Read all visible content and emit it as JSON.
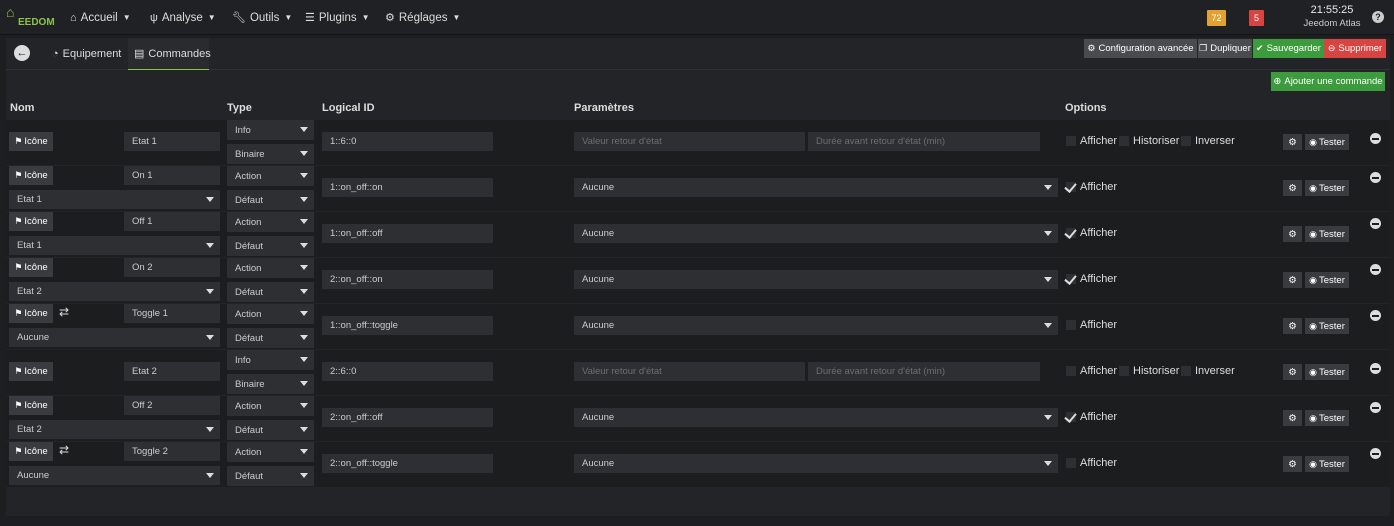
{
  "app": {
    "logo_text": "EEDOM"
  },
  "nav": [
    {
      "label": "Accueil",
      "icon": "home-icon"
    },
    {
      "label": "Analyse",
      "icon": "analysis-icon"
    },
    {
      "label": "Outils",
      "icon": "wrench-icon"
    },
    {
      "label": "Plugins",
      "icon": "list-icon"
    },
    {
      "label": "Réglages",
      "icon": "cog-icon"
    }
  ],
  "badges": [
    {
      "value": "72",
      "color": "#e2a232"
    },
    {
      "value": "5",
      "color": "#d64541"
    }
  ],
  "clock": {
    "time": "21:55:25",
    "name": "Jeedom Atlas"
  },
  "tabs": {
    "equipement": "Equipement",
    "commandes": "Commandes"
  },
  "actions": {
    "config": "Configuration avancée",
    "dupliquer": "Dupliquer",
    "sauvegarder": "Sauvegarder",
    "supprimer": "Supprimer"
  },
  "colors": {
    "green": "#3c9b3c",
    "red": "#d64541",
    "grey_btn": "#4a4b4e"
  },
  "add_command": "Ajouter une commande",
  "headers": {
    "nom": "Nom",
    "type": "Type",
    "logical_id": "Logical ID",
    "parametres": "Paramètres",
    "options": "Options"
  },
  "labels": {
    "icone": "Icône",
    "tester": "Tester",
    "afficher": "Afficher",
    "historiser": "Historiser",
    "inverser": "Inverser",
    "ph_valeur": "Valeur retour d'état",
    "ph_duree": "Durée avant retour d'état (min)"
  },
  "commands": [
    {
      "name": "Etat 1",
      "type": "Info",
      "subtype": "Binaire",
      "logical_id": "1::6::0",
      "kind": "info"
    },
    {
      "name": "On 1",
      "linked": "Etat 1",
      "type": "Action",
      "subtype": "Défaut",
      "logical_id": "1::on_off::on",
      "param": "Aucune",
      "afficher": true,
      "kind": "action"
    },
    {
      "name": "Off 1",
      "linked": "Etat 1",
      "type": "Action",
      "subtype": "Défaut",
      "logical_id": "1::on_off::off",
      "param": "Aucune",
      "afficher": true,
      "kind": "action"
    },
    {
      "name": "On 2",
      "linked": "Etat 2",
      "type": "Action",
      "subtype": "Défaut",
      "logical_id": "2::on_off::on",
      "param": "Aucune",
      "afficher": true,
      "kind": "action"
    },
    {
      "name": "Toggle 1",
      "linked": "Aucune",
      "type": "Action",
      "subtype": "Défaut",
      "logical_id": "1::on_off::toggle",
      "param": "Aucune",
      "afficher": false,
      "kind": "action"
    },
    {
      "name": "Etat 2",
      "type": "Info",
      "subtype": "Binaire",
      "logical_id": "2::6::0",
      "kind": "info"
    },
    {
      "name": "Off 2",
      "linked": "Etat 2",
      "type": "Action",
      "subtype": "Défaut",
      "logical_id": "2::on_off::off",
      "param": "Aucune",
      "afficher": true,
      "kind": "action"
    },
    {
      "name": "Toggle 2",
      "linked": "Aucune",
      "type": "Action",
      "subtype": "Défaut",
      "logical_id": "2::on_off::toggle",
      "param": "Aucune",
      "afficher": false,
      "kind": "action"
    }
  ]
}
